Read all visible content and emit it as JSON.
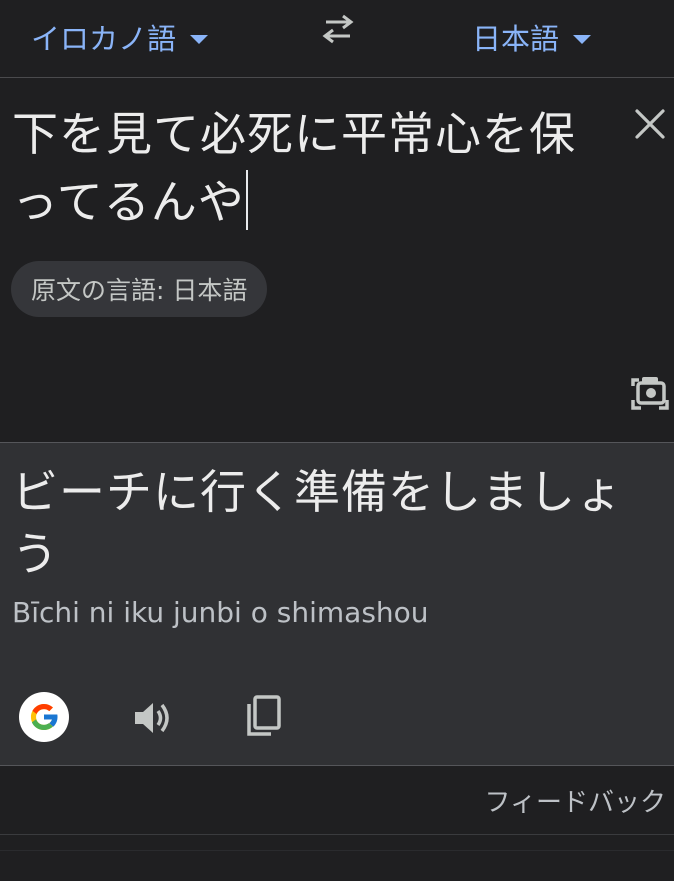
{
  "language_bar": {
    "source_language": "イロカノ語",
    "target_language": "日本語",
    "swap_icon": "swap-arrows-icon",
    "dropdown_icon": "caret-down-icon"
  },
  "input": {
    "source_text": "下を見て必死に平常心を保ってるんや",
    "detected_language": "原文の言語: 日本語",
    "clear_icon": "close-icon",
    "camera_icon": "camera-icon"
  },
  "output": {
    "translated_text": "ビーチに行く準備をしましょう",
    "romanized_text": "Bīchi ni iku junbi o shimashou",
    "actions": {
      "google_icon": "google-logo-icon",
      "speaker_icon": "speaker-icon",
      "copy_icon": "copy-icon"
    }
  },
  "feedback": {
    "label": "フィードバック"
  },
  "colors": {
    "accent": "#8ab4f8",
    "background": "#1f1f21",
    "output_background": "#303134",
    "text": "#ececec",
    "secondary_text": "#bdc1c6"
  }
}
